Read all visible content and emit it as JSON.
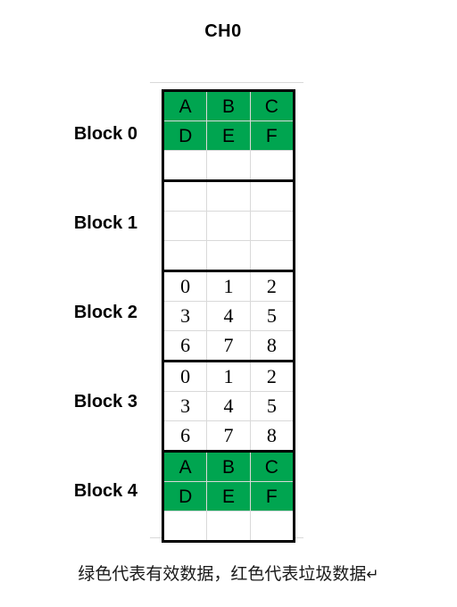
{
  "title": "CH0",
  "colors": {
    "valid_green": "#00a550",
    "block_border": "#000000",
    "cell_grid": "#d9d9d9",
    "background": "#ffffff"
  },
  "diagram": {
    "columns": 3,
    "rows_per_block": 3,
    "blocks": [
      {
        "label": "Block 0",
        "rows": [
          [
            {
              "text": "A",
              "state": "valid"
            },
            {
              "text": "B",
              "state": "valid"
            },
            {
              "text": "C",
              "state": "valid"
            }
          ],
          [
            {
              "text": "D",
              "state": "valid"
            },
            {
              "text": "E",
              "state": "valid"
            },
            {
              "text": "F",
              "state": "valid"
            }
          ],
          [
            {
              "text": "",
              "state": "empty"
            },
            {
              "text": "",
              "state": "empty"
            },
            {
              "text": "",
              "state": "empty"
            }
          ]
        ]
      },
      {
        "label": "Block 1",
        "rows": [
          [
            {
              "text": "",
              "state": "empty"
            },
            {
              "text": "",
              "state": "empty"
            },
            {
              "text": "",
              "state": "empty"
            }
          ],
          [
            {
              "text": "",
              "state": "empty"
            },
            {
              "text": "",
              "state": "empty"
            },
            {
              "text": "",
              "state": "empty"
            }
          ],
          [
            {
              "text": "",
              "state": "empty"
            },
            {
              "text": "",
              "state": "empty"
            },
            {
              "text": "",
              "state": "empty"
            }
          ]
        ]
      },
      {
        "label": "Block 2",
        "rows": [
          [
            {
              "text": "0",
              "state": "empty"
            },
            {
              "text": "1",
              "state": "empty"
            },
            {
              "text": "2",
              "state": "empty"
            }
          ],
          [
            {
              "text": "3",
              "state": "empty"
            },
            {
              "text": "4",
              "state": "empty"
            },
            {
              "text": "5",
              "state": "empty"
            }
          ],
          [
            {
              "text": "6",
              "state": "empty"
            },
            {
              "text": "7",
              "state": "empty"
            },
            {
              "text": "8",
              "state": "empty"
            }
          ]
        ]
      },
      {
        "label": "Block 3",
        "rows": [
          [
            {
              "text": "0",
              "state": "empty"
            },
            {
              "text": "1",
              "state": "empty"
            },
            {
              "text": "2",
              "state": "empty"
            }
          ],
          [
            {
              "text": "3",
              "state": "empty"
            },
            {
              "text": "4",
              "state": "empty"
            },
            {
              "text": "5",
              "state": "empty"
            }
          ],
          [
            {
              "text": "6",
              "state": "empty"
            },
            {
              "text": "7",
              "state": "empty"
            },
            {
              "text": "8",
              "state": "empty"
            }
          ]
        ]
      },
      {
        "label": "Block 4",
        "rows": [
          [
            {
              "text": "A",
              "state": "valid"
            },
            {
              "text": "B",
              "state": "valid"
            },
            {
              "text": "C",
              "state": "valid"
            }
          ],
          [
            {
              "text": "D",
              "state": "valid"
            },
            {
              "text": "E",
              "state": "valid"
            },
            {
              "text": "F",
              "state": "valid"
            }
          ],
          [
            {
              "text": "",
              "state": "empty"
            },
            {
              "text": "",
              "state": "empty"
            },
            {
              "text": "",
              "state": "empty"
            }
          ]
        ]
      }
    ]
  },
  "caption": {
    "text": "绿色代表有效数据，红色代表垃圾数据",
    "paragraph_mark": "↵"
  }
}
